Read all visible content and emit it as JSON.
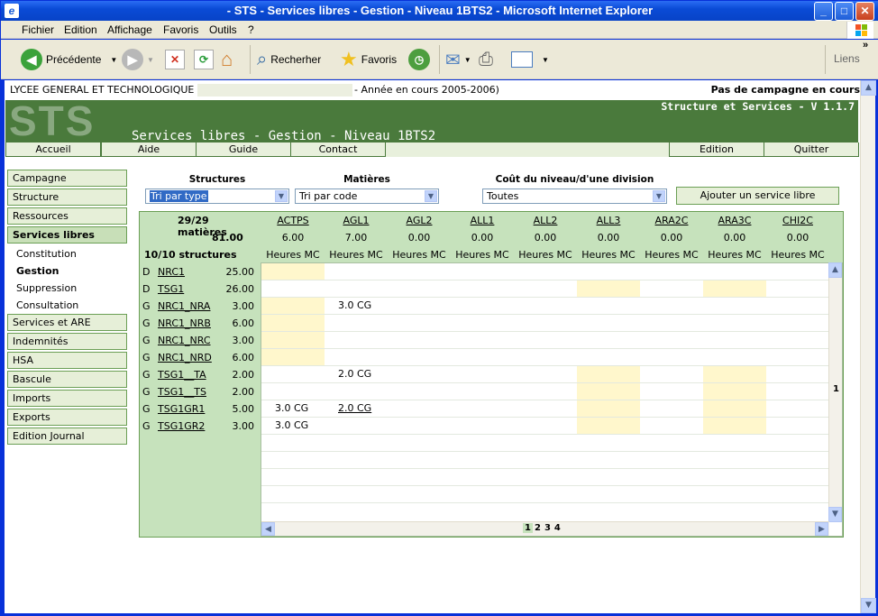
{
  "window": {
    "title": "- STS - Services libres - Gestion - Niveau 1BTS2 - Microsoft Internet Explorer"
  },
  "menu": [
    "Fichier",
    "Edition",
    "Affichage",
    "Favoris",
    "Outils",
    "?"
  ],
  "toolbar": {
    "back": "Précédente",
    "search": "Recherher",
    "favorites": "Favoris",
    "links": "Liens"
  },
  "header": {
    "school": "LYCEE GENERAL ET TECHNOLOGIQUE",
    "year": "- Année en cours 2005-2006)",
    "campaign": "Pas de campagne en cours"
  },
  "banner": {
    "logo": "STS",
    "version": "Structure et Services - V 1.1.7",
    "title": "Services libres - Gestion - Niveau 1BTS2"
  },
  "nav": {
    "accueil": "Accueil",
    "aide": "Aide",
    "guide": "Guide",
    "contact": "Contact",
    "edition": "Edition",
    "quitter": "Quitter"
  },
  "sidebar": {
    "items": [
      "Campagne",
      "Structure",
      "Ressources",
      "Services libres",
      "Services et ARE",
      "Indemnités",
      "HSA",
      "Bascule",
      "Imports",
      "Exports",
      "Edition Journal"
    ],
    "subs": [
      "Constitution",
      "Gestion",
      "Suppression",
      "Consultation"
    ]
  },
  "filters": {
    "structures_label": "Structures",
    "structures_value": "Tri par type",
    "matieres_label": "Matières",
    "matieres_value": "Tri par code",
    "cout_label": "Coût du niveau/d'une division",
    "cout_value": "Toutes",
    "add_button": "Ajouter un service libre"
  },
  "grid": {
    "matieres_count": "29/29 matières",
    "total": "81.00",
    "structures_count": "10/10 structures",
    "columns": [
      {
        "code": "ACTPS",
        "total": "6.00",
        "sub": "Heures MC"
      },
      {
        "code": "AGL1",
        "total": "7.00",
        "sub": "Heures MC"
      },
      {
        "code": "AGL2",
        "total": "0.00",
        "sub": "Heures MC"
      },
      {
        "code": "ALL1",
        "total": "0.00",
        "sub": "Heures MC"
      },
      {
        "code": "ALL2",
        "total": "0.00",
        "sub": "Heures MC"
      },
      {
        "code": "ALL3",
        "total": "0.00",
        "sub": "Heures MC"
      },
      {
        "code": "ARA2C",
        "total": "0.00",
        "sub": "Heures MC"
      },
      {
        "code": "ARA3C",
        "total": "0.00",
        "sub": "Heures MC"
      },
      {
        "code": "CHI2C",
        "total": "0.00",
        "sub": "Heures MC"
      }
    ],
    "rows": [
      {
        "type": "D",
        "name": "NRC1",
        "hours": "25.00",
        "cells": [
          "",
          "",
          "",
          "",
          "",
          "",
          "",
          "",
          ""
        ],
        "y": [
          0
        ]
      },
      {
        "type": "D",
        "name": "TSG1",
        "hours": "26.00",
        "cells": [
          "",
          "",
          "",
          "",
          "",
          "",
          "",
          "",
          ""
        ],
        "y": [
          5,
          7
        ]
      },
      {
        "type": "G",
        "name": "NRC1_NRA",
        "hours": "3.00",
        "cells": [
          "",
          "3.0 CG",
          "",
          "",
          "",
          "",
          "",
          "",
          ""
        ],
        "y": [
          0
        ]
      },
      {
        "type": "G",
        "name": "NRC1_NRB",
        "hours": "6.00",
        "cells": [
          "",
          "",
          "",
          "",
          "",
          "",
          "",
          "",
          ""
        ],
        "y": [
          0
        ]
      },
      {
        "type": "G",
        "name": "NRC1_NRC",
        "hours": "3.00",
        "cells": [
          "",
          "",
          "",
          "",
          "",
          "",
          "",
          "",
          ""
        ],
        "y": [
          0
        ]
      },
      {
        "type": "G",
        "name": "NRC1_NRD",
        "hours": "6.00",
        "cells": [
          "",
          "",
          "",
          "",
          "",
          "",
          "",
          "",
          ""
        ],
        "y": [
          0
        ]
      },
      {
        "type": "G",
        "name": "TSG1__TA",
        "hours": "2.00",
        "cells": [
          "",
          "2.0 CG",
          "",
          "",
          "",
          "",
          "",
          "",
          ""
        ],
        "y": [
          5,
          7
        ]
      },
      {
        "type": "G",
        "name": "TSG1__TS",
        "hours": "2.00",
        "cells": [
          "",
          "",
          "",
          "",
          "",
          "",
          "",
          "",
          ""
        ],
        "y": [
          5,
          7
        ]
      },
      {
        "type": "G",
        "name": "TSG1GR1",
        "hours": "5.00",
        "cells": [
          "3.0 CG",
          "2.0 CG",
          "",
          "",
          "",
          "",
          "",
          "",
          ""
        ],
        "y": [
          5,
          7
        ]
      },
      {
        "type": "G",
        "name": "TSG1GR2",
        "hours": "3.00",
        "cells": [
          "3.0 CG",
          "",
          "",
          "",
          "",
          "",
          "",
          "",
          ""
        ],
        "y": [
          5,
          7
        ]
      }
    ],
    "vpage": "1",
    "pages": [
      "1",
      "2",
      "3",
      "4"
    ]
  }
}
